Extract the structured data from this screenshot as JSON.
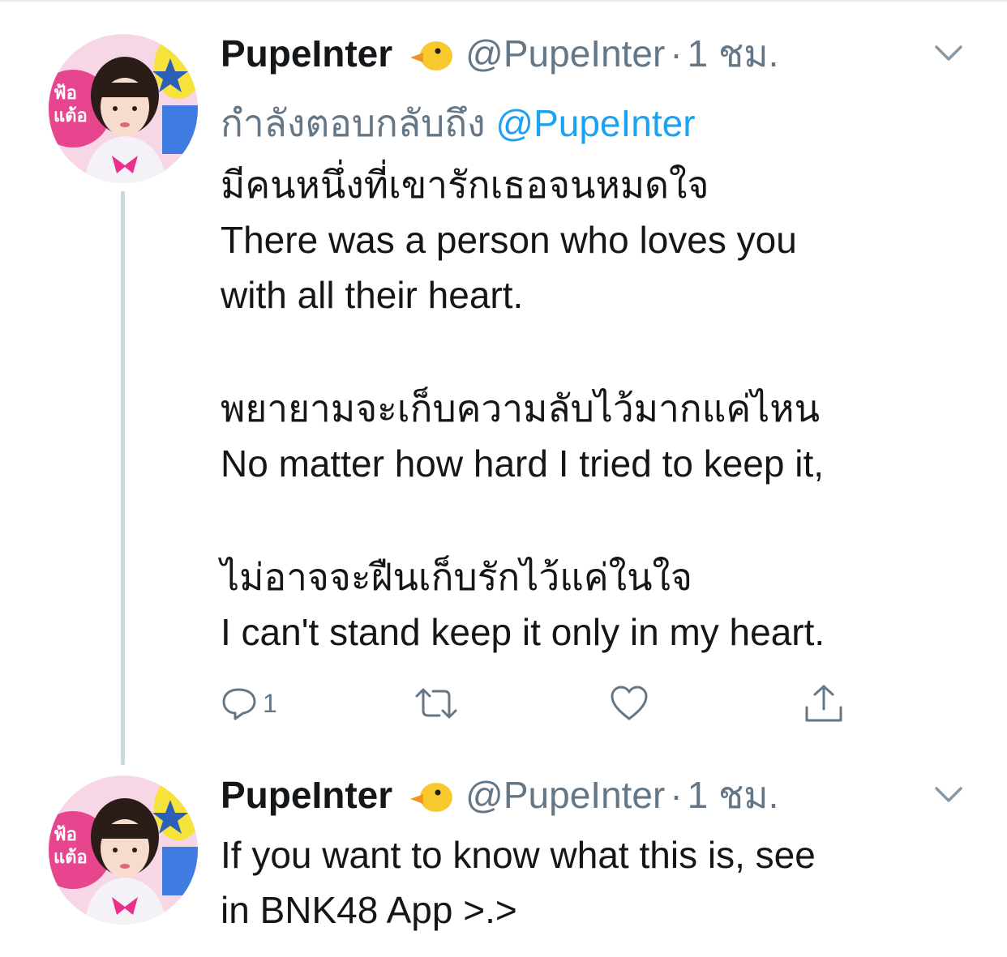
{
  "tweets": [
    {
      "author": {
        "name": "PupeInter",
        "emoji": "duck-emoji",
        "handle": "@PupeInter",
        "time": "1 ชม."
      },
      "reply_to": {
        "prefix": "กำลังตอบกลับถึง ",
        "mention": "@PupeInter"
      },
      "lines": [
        "มีคนหนึ่งที่เขารักเธอจนหมดใจ",
        "There was a person who loves you",
        "with all their heart.",
        "",
        "พยายามจะเก็บความลับไว้มากแค่ไหน",
        "No matter how hard I tried to keep it,",
        "",
        "ไม่อาจจะฝืนเก็บรักไว้แค่ในใจ",
        "I can't stand keep it only in my heart."
      ],
      "actions": {
        "reply_count": "1",
        "retweet_count": "",
        "like_count": ""
      }
    },
    {
      "author": {
        "name": "PupeInter",
        "emoji": "duck-emoji",
        "handle": "@PupeInter",
        "time": "1 ชม."
      },
      "lines": [
        "If you want to know what this is, see",
        "in BNK48 App >.>"
      ]
    }
  ],
  "separator": "·",
  "colors": {
    "text": "#14171a",
    "secondary": "#657786",
    "link": "#1da1f2",
    "thread_line": "#ccd6dd"
  },
  "icons": [
    "reply-icon",
    "retweet-icon",
    "like-icon",
    "share-icon",
    "chevron-down-icon",
    "duck-emoji"
  ]
}
